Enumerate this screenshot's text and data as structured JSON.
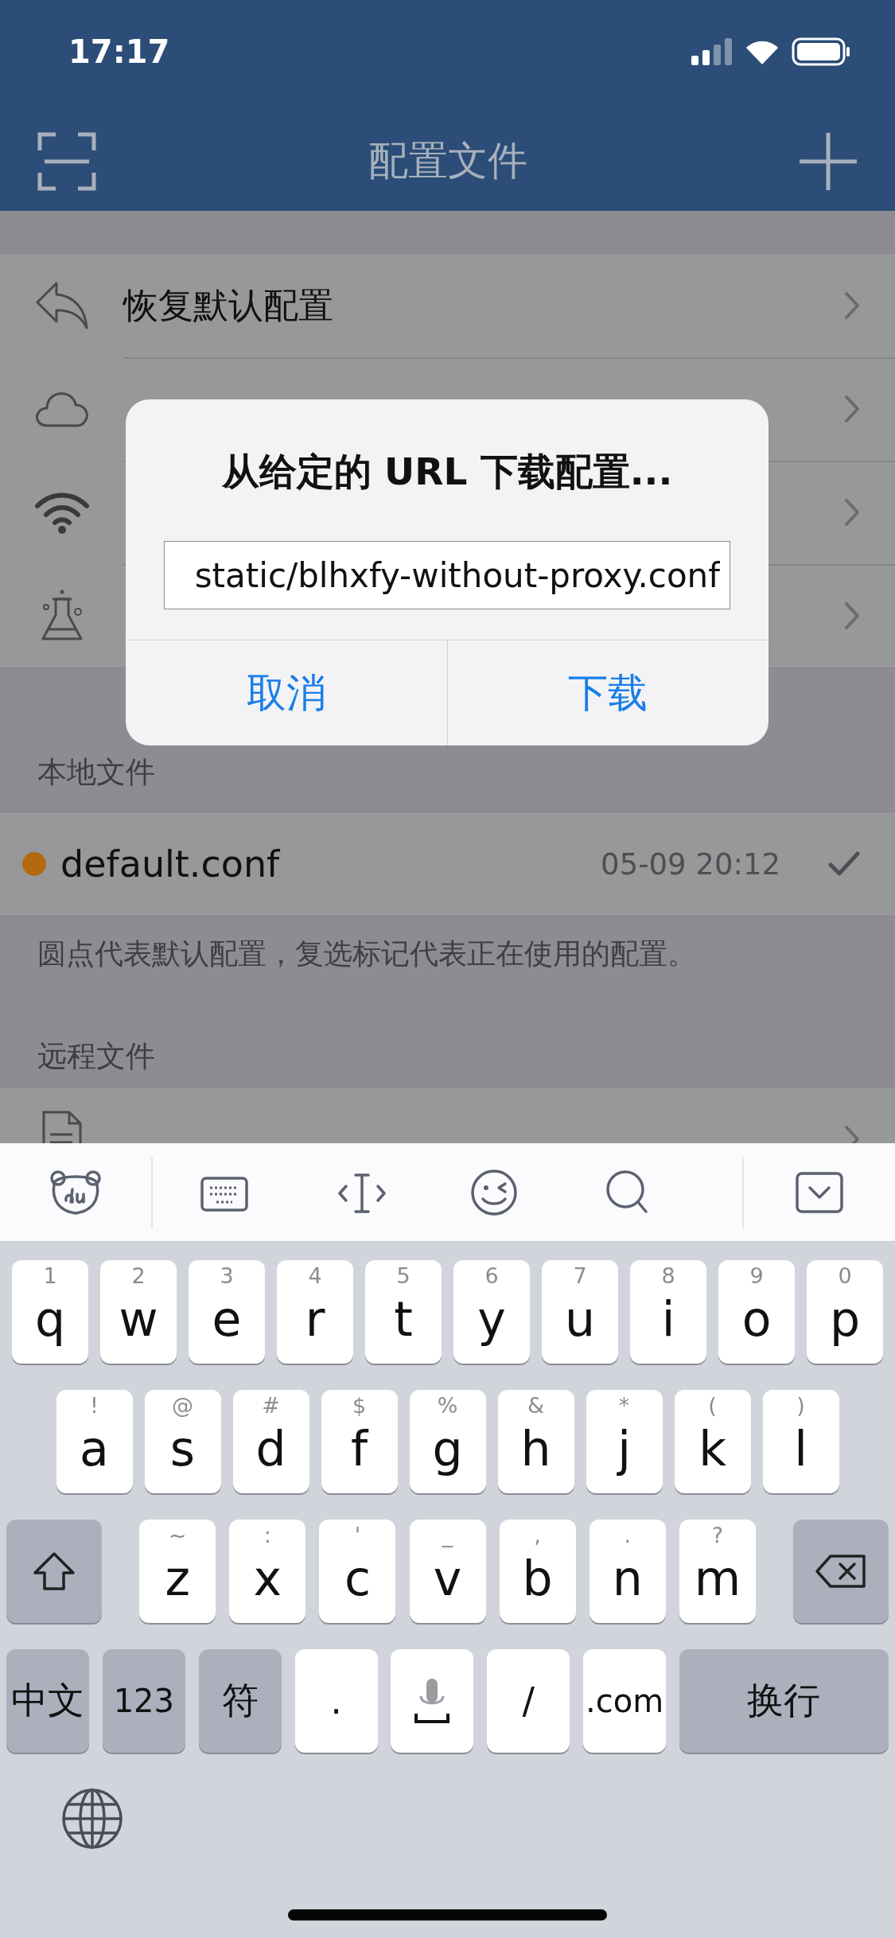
{
  "status_bar": {
    "time": "17:17"
  },
  "nav": {
    "title": "配置文件"
  },
  "actions": [
    {
      "kind": "reply",
      "label": "恢复默认配置"
    },
    {
      "kind": "cloud"
    },
    {
      "kind": "wifi"
    },
    {
      "kind": "flask"
    }
  ],
  "local": {
    "header": "本地文件",
    "files": [
      {
        "name": "default.conf",
        "time": "05-09 20:12",
        "default": true,
        "in_use": true,
        "color": "#b4690e"
      }
    ],
    "footer": "圆点代表默认配置，复选标记代表正在使用的配置。"
  },
  "remote": {
    "header": "远程文件",
    "rows": [
      {
        "kind": "doc"
      }
    ]
  },
  "dialog": {
    "title": "从给定的 URL 下载配置...",
    "value": "static/blhxfy-without-proxy.conf",
    "buttons": [
      "取消",
      "下载"
    ]
  },
  "keyboard": {
    "rows": [
      {
        "keys": [
          {
            "kind": "letter",
            "label": "q",
            "hint": "1"
          },
          {
            "kind": "letter",
            "label": "w",
            "hint": "2"
          },
          {
            "kind": "letter",
            "label": "e",
            "hint": "3"
          },
          {
            "kind": "letter",
            "label": "r",
            "hint": "4"
          },
          {
            "kind": "letter",
            "label": "t",
            "hint": "5"
          },
          {
            "kind": "letter",
            "label": "y",
            "hint": "6"
          },
          {
            "kind": "letter",
            "label": "u",
            "hint": "7"
          },
          {
            "kind": "letter",
            "label": "i",
            "hint": "8"
          },
          {
            "kind": "letter",
            "label": "o",
            "hint": "9"
          },
          {
            "kind": "letter",
            "label": "p",
            "hint": "0"
          }
        ]
      },
      {
        "keys": [
          {
            "kind": "letter",
            "label": "a",
            "hint": "!"
          },
          {
            "kind": "letter",
            "label": "s",
            "hint": "@"
          },
          {
            "kind": "letter",
            "label": "d",
            "hint": "#"
          },
          {
            "kind": "letter",
            "label": "f",
            "hint": "$"
          },
          {
            "kind": "letter",
            "label": "g",
            "hint": "%"
          },
          {
            "kind": "letter",
            "label": "h",
            "hint": "&"
          },
          {
            "kind": "letter",
            "label": "j",
            "hint": "*"
          },
          {
            "kind": "letter",
            "label": "k",
            "hint": "("
          },
          {
            "kind": "letter",
            "label": "l",
            "hint": ")"
          }
        ]
      },
      {
        "keys": [
          {
            "kind": "shift"
          },
          {
            "kind": "letter",
            "label": "z",
            "hint": "~"
          },
          {
            "kind": "letter",
            "label": "x",
            "hint": ":"
          },
          {
            "kind": "letter",
            "label": "c",
            "hint": "'"
          },
          {
            "kind": "letter",
            "label": "v",
            "hint": "_"
          },
          {
            "kind": "letter",
            "label": "b",
            "hint": ","
          },
          {
            "kind": "letter",
            "label": "n",
            "hint": "."
          },
          {
            "kind": "letter",
            "label": "m",
            "hint": "?"
          },
          {
            "kind": "backspace"
          }
        ]
      },
      {
        "keys": [
          {
            "kind": "func",
            "label": "中文"
          },
          {
            "kind": "func",
            "label": "123"
          },
          {
            "kind": "func",
            "label": "符"
          },
          {
            "kind": "letter",
            "label": "."
          },
          {
            "kind": "mic"
          },
          {
            "kind": "letter",
            "label": "/"
          },
          {
            "kind": "letter",
            "label": ".com"
          },
          {
            "kind": "wide",
            "label": "换行"
          }
        ]
      }
    ]
  }
}
